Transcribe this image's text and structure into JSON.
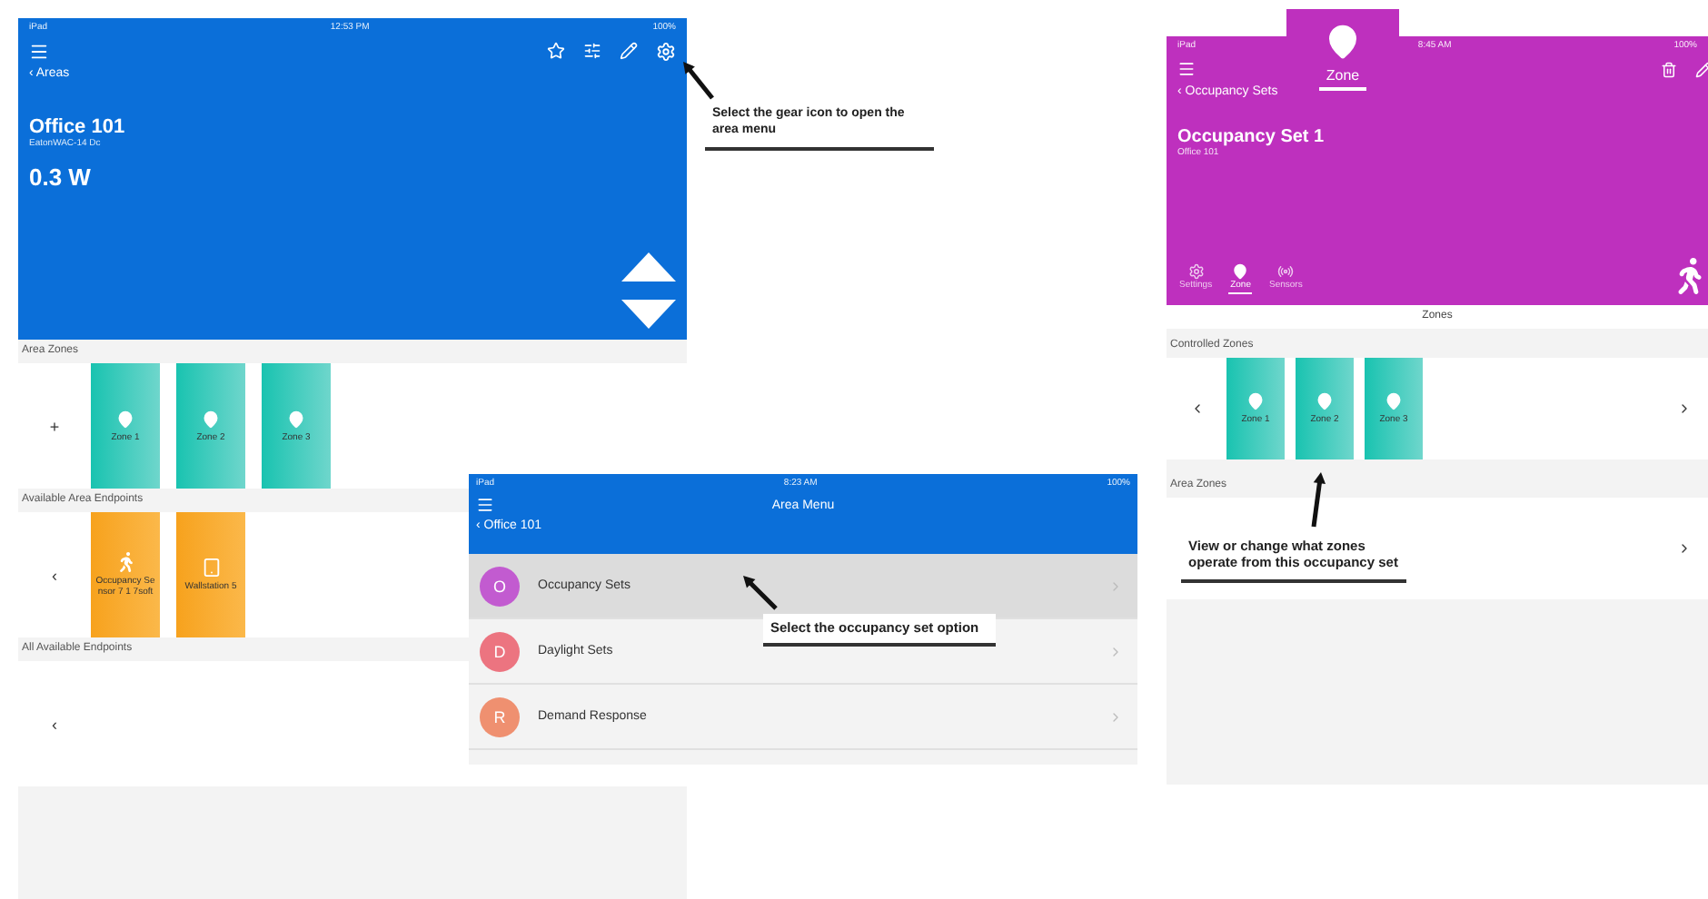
{
  "area_screen": {
    "status": {
      "device": "iPad",
      "time": "12:53 PM",
      "battery": "100%"
    },
    "back": "‹ Areas",
    "title": "Office 101",
    "subtitle": "EatonWAC-14 Dc",
    "power": "0.3 W",
    "sections": [
      {
        "label": "Area Zones",
        "side": "+",
        "tiles": [
          {
            "label": "Zone 1",
            "kind": "zone"
          },
          {
            "label": "Zone 2",
            "kind": "zone"
          },
          {
            "label": "Zone 3",
            "kind": "zone"
          }
        ]
      },
      {
        "label": "Available Area Endpoints",
        "side": "‹",
        "tiles": [
          {
            "label": "Occupancy Sensor 7 1 7soft",
            "kind": "sensor"
          },
          {
            "label": "Wallstation 5",
            "kind": "wallstation"
          }
        ]
      },
      {
        "label": "All Available Endpoints",
        "side": "‹"
      }
    ]
  },
  "area_menu": {
    "status": {
      "device": "iPad",
      "time": "8:23 AM",
      "battery": "100%"
    },
    "title": "Area Menu",
    "back": "‹ Office 101",
    "items": [
      {
        "letter": "O",
        "label": "Occupancy Sets",
        "color": "#c25bd0",
        "selected": true
      },
      {
        "letter": "D",
        "label": "Daylight Sets",
        "color": "#ec7480",
        "selected": false
      },
      {
        "letter": "R",
        "label": "Demand Response",
        "color": "#ef9070",
        "selected": false
      }
    ]
  },
  "occupancy_screen": {
    "status": {
      "device": "iPad",
      "time": "8:45 AM",
      "battery": "100%"
    },
    "back": "‹ Occupancy Sets",
    "zone_tab": "Zone",
    "title": "Occupancy Set 1",
    "subtitle": "Office 101",
    "tabs": [
      {
        "label": "Settings",
        "kind": "gear",
        "selected": false
      },
      {
        "label": "Zone",
        "kind": "pin",
        "selected": true
      },
      {
        "label": "Sensors",
        "kind": "signal",
        "selected": false
      }
    ],
    "section_title": "Zones",
    "sections": [
      {
        "label": "Controlled Zones",
        "tiles": [
          {
            "label": "Zone 1"
          },
          {
            "label": "Zone 2"
          },
          {
            "label": "Zone 3"
          }
        ]
      },
      {
        "label": "Area Zones"
      }
    ]
  },
  "annotations": [
    {
      "text": "Select the gear icon to open the area menu"
    },
    {
      "text": "Select the occupancy set option"
    },
    {
      "text": "View or change what zones operate from this occupancy set"
    }
  ]
}
